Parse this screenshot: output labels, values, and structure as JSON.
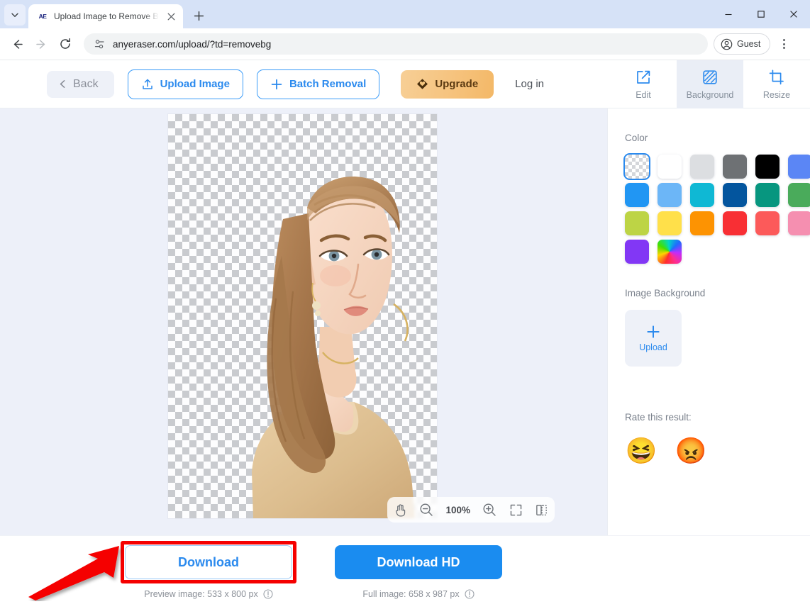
{
  "browser": {
    "tab": {
      "title": "Upload Image to Remove Bg",
      "favicon_label": "AE",
      "close_icon": "close-icon"
    },
    "newtab_label": "+",
    "window_controls": {
      "minimize": "minimize-icon",
      "maximize": "maximize-icon",
      "close": "close-icon"
    },
    "url": "anyeraser.com/upload/?td=removebg",
    "profile_label": "Guest",
    "nav": {
      "back": "back-arrow-icon",
      "forward": "forward-arrow-icon",
      "reload": "reload-icon"
    }
  },
  "app_header": {
    "back_label": "Back",
    "upload_image_label": "Upload Image",
    "batch_removal_label": "Batch Removal",
    "upgrade_label": "Upgrade",
    "login_label": "Log in",
    "mode_tabs": [
      {
        "label": "Edit",
        "icon": "edit-square-icon",
        "active": false
      },
      {
        "label": "Background",
        "icon": "background-hatch-icon",
        "active": true
      },
      {
        "label": "Resize",
        "icon": "crop-icon",
        "active": false
      }
    ]
  },
  "canvas": {
    "zoom_level": "100%",
    "tools": [
      "hand-tool-icon",
      "zoom-out-icon",
      "zoom-level",
      "zoom-in-icon",
      "fit-screen-icon",
      "compare-split-icon"
    ]
  },
  "side_panel": {
    "color_label": "Color",
    "colors": [
      {
        "name": "transparent",
        "hex": "transparent",
        "selected": true
      },
      {
        "name": "white",
        "hex": "#ffffff",
        "selected": false
      },
      {
        "name": "light-gray",
        "hex": "#dcdee1",
        "selected": false
      },
      {
        "name": "gray",
        "hex": "#6e7174",
        "selected": false
      },
      {
        "name": "black",
        "hex": "#000000",
        "selected": false
      },
      {
        "name": "periwinkle",
        "hex": "#5b86f5",
        "selected": false
      },
      {
        "name": "blue",
        "hex": "#2196f3",
        "selected": false
      },
      {
        "name": "light-blue",
        "hex": "#6cb6f7",
        "selected": false
      },
      {
        "name": "cyan",
        "hex": "#0fb8d4",
        "selected": false
      },
      {
        "name": "navy",
        "hex": "#03559e",
        "selected": false
      },
      {
        "name": "teal",
        "hex": "#07967f",
        "selected": false
      },
      {
        "name": "green",
        "hex": "#4aab5b",
        "selected": false
      },
      {
        "name": "lime",
        "hex": "#bdd445",
        "selected": false
      },
      {
        "name": "yellow",
        "hex": "#ffe04a",
        "selected": false
      },
      {
        "name": "orange",
        "hex": "#fd9302",
        "selected": false
      },
      {
        "name": "red",
        "hex": "#f82f34",
        "selected": false
      },
      {
        "name": "coral",
        "hex": "#fc5a5a",
        "selected": false
      },
      {
        "name": "pink",
        "hex": "#f58fb0",
        "selected": false
      },
      {
        "name": "purple",
        "hex": "#8237f5",
        "selected": false
      },
      {
        "name": "rainbow",
        "hex": "rainbow",
        "selected": false
      }
    ],
    "image_background_label": "Image Background",
    "upload_label": "Upload",
    "rate_label": "Rate this result:",
    "rate_options": [
      {
        "name": "laughing-emoji",
        "glyph": "😆"
      },
      {
        "name": "angry-emoji",
        "glyph": "😡"
      }
    ]
  },
  "bottom_bar": {
    "download_label": "Download",
    "download_caption": "Preview image: 533 x 800 px",
    "download_hd_label": "Download HD",
    "download_hd_caption": "Full image: 658 x 987 px",
    "info_icon": "info-icon"
  },
  "annotation": {
    "highlight_color": "#f50000",
    "arrow_color": "#f50000",
    "target": "download-button"
  }
}
